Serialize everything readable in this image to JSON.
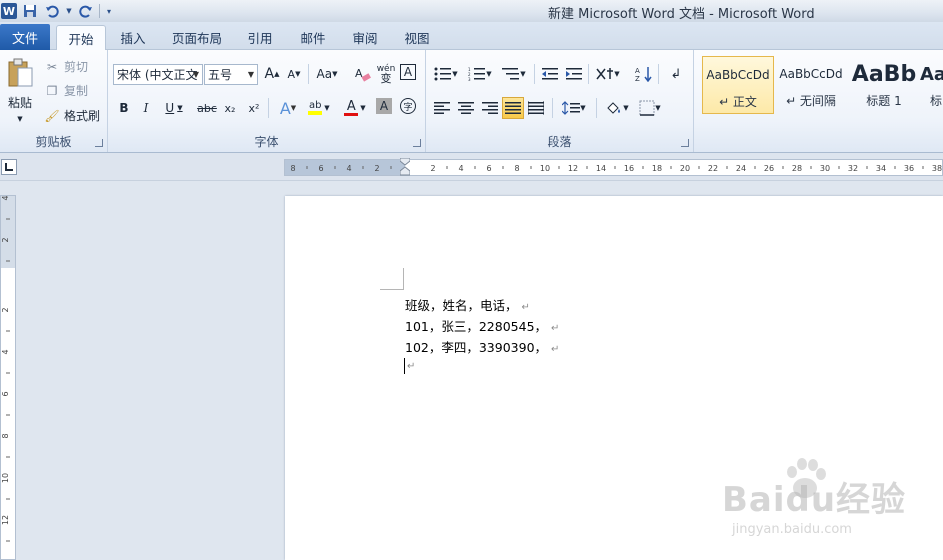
{
  "window": {
    "title": "新建 Microsoft Word 文档  -  Microsoft Word",
    "app_icon": "W"
  },
  "qat": {
    "icons": [
      "save-icon",
      "undo-icon",
      "redo-icon",
      "customize-icon"
    ]
  },
  "tabs": [
    {
      "label": "文件"
    },
    {
      "label": "开始"
    },
    {
      "label": "插入"
    },
    {
      "label": "页面布局"
    },
    {
      "label": "引用"
    },
    {
      "label": "邮件"
    },
    {
      "label": "审阅"
    },
    {
      "label": "视图"
    }
  ],
  "clipboard": {
    "paste": "粘贴",
    "cut": "剪切",
    "copy": "复制",
    "format_painter": "格式刷",
    "label": "剪贴板"
  },
  "font": {
    "font_name": "宋体 (中文正文",
    "font_size": "五号",
    "grow": "A",
    "shrink": "A",
    "change_case": "Aa",
    "clear": "A",
    "pinyin": "wén",
    "border": "A",
    "bold": "B",
    "italic": "I",
    "underline": "U",
    "strike": "abc",
    "sub": "x₂",
    "sup": "x²",
    "effects": "A",
    "highlight": "ab",
    "color": "A",
    "shade": "A",
    "enclose": "字",
    "label": "字体"
  },
  "paragraph": {
    "label": "段落"
  },
  "styles": [
    {
      "preview": "AaBbCcDd",
      "name": "↵ 正文"
    },
    {
      "preview": "AaBbCcDd",
      "name": "↵ 无间隔"
    },
    {
      "preview": "AaBb",
      "name": "标题 1"
    },
    {
      "preview": "Aa",
      "name": "标"
    }
  ],
  "ruler": {
    "h_ticks": [
      "8",
      "6",
      "4",
      "2",
      "2",
      "4",
      "6",
      "8",
      "10",
      "12",
      "14",
      "16",
      "18",
      "20",
      "22",
      "24",
      "26",
      "28",
      "30",
      "32",
      "34",
      "36",
      "38"
    ],
    "v_ticks": [
      "4",
      "2",
      "2",
      "4",
      "6",
      "8",
      "10",
      "12"
    ],
    "corner": "L"
  },
  "document": {
    "lines": [
      "班级，姓名，电话，",
      "101，张三，2280545，",
      "102，李四，3390390，"
    ],
    "para_mark": "↵"
  },
  "watermark": {
    "text": "Baidu经验",
    "url": "jingyan.baidu.com"
  }
}
